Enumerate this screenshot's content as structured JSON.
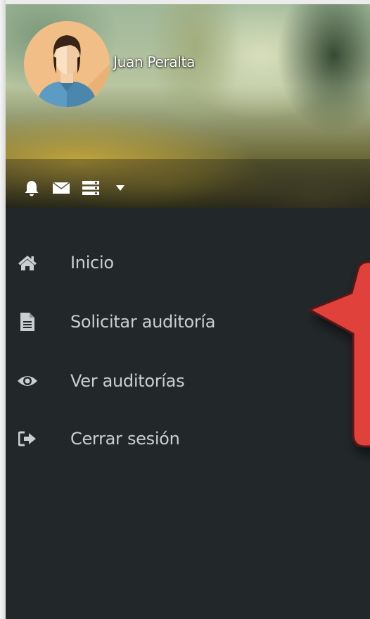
{
  "user": {
    "name": "Juan Peralta"
  },
  "toolbar": {
    "icons": [
      "bell-icon",
      "envelope-icon",
      "server-list-icon",
      "caret-down-icon"
    ]
  },
  "menu": {
    "items": [
      {
        "label": "Inicio",
        "icon": "home-icon"
      },
      {
        "label": "Solicitar auditoría",
        "icon": "file-document-icon"
      },
      {
        "label": "Ver auditorías",
        "icon": "eye-icon"
      },
      {
        "label": "Cerrar sesión",
        "icon": "sign-out-icon"
      }
    ]
  },
  "colors": {
    "sidebar_bg": "#22272a",
    "menu_text": "#c9ced1",
    "callout_fill": "#e0423a",
    "callout_stroke": "#5a1512"
  }
}
